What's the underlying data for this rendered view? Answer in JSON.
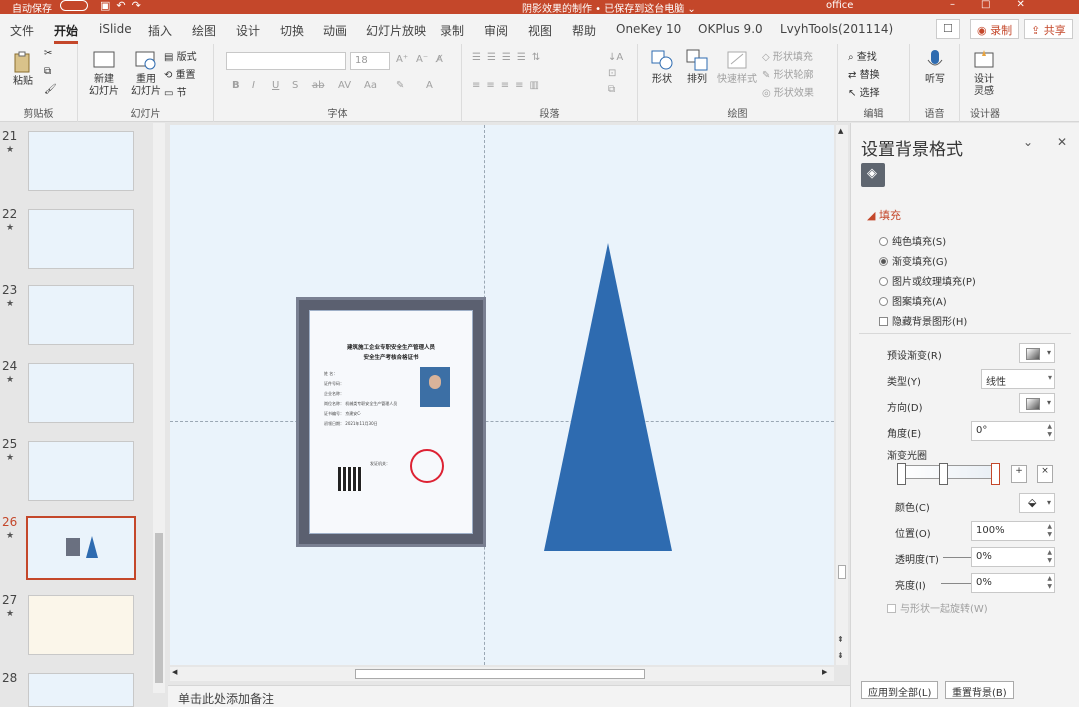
{
  "titlebar": {
    "autosave": "自动保存",
    "autosave_state": "关",
    "doc_title": "阴影效果的制作 • 已保存到这台电脑 ⌄",
    "account": "office",
    "qat_icons": [
      "save-icon",
      "undo-icon",
      "redo-icon"
    ]
  },
  "tabs": [
    {
      "label": "文件"
    },
    {
      "label": "开始",
      "active": true
    },
    {
      "label": "iSlide"
    },
    {
      "label": "插入"
    },
    {
      "label": "绘图"
    },
    {
      "label": "设计"
    },
    {
      "label": "切换"
    },
    {
      "label": "动画"
    },
    {
      "label": "幻灯片放映"
    },
    {
      "label": "录制"
    },
    {
      "label": "审阅"
    },
    {
      "label": "视图"
    },
    {
      "label": "帮助"
    },
    {
      "label": "OneKey 10"
    },
    {
      "label": "OKPlus 9.0"
    },
    {
      "label": "LvyhTools(201114)"
    }
  ],
  "tab_buttons": {
    "record": "录制",
    "share": "共享"
  },
  "ribbon": {
    "clipboard": {
      "paste": "粘贴",
      "group": "剪贴板"
    },
    "slides": {
      "new_slide": "新建\n幻灯片",
      "reuse": "重用\n幻灯片",
      "layout": "版式",
      "reset": "重置",
      "section": "节",
      "group": "幻灯片"
    },
    "font": {
      "size": "18",
      "group": "字体",
      "bold": "B",
      "italic": "I",
      "underline": "U",
      "strike": "S"
    },
    "paragraph": {
      "group": "段落"
    },
    "drawing": {
      "shapes": "形状",
      "arrange": "排列",
      "quick_styles": "快速样式",
      "fill": "形状填充",
      "outline": "形状轮廓",
      "effects": "形状效果",
      "group": "绘图"
    },
    "editing": {
      "find": "查找",
      "replace": "替换",
      "select": "选择",
      "group": "编辑"
    },
    "voice": {
      "dictate": "听写",
      "group": "语音"
    },
    "designer": {
      "ideas": "设计\n灵感",
      "group": "设计器"
    }
  },
  "thumbnails": [
    {
      "num": "21",
      "star": "★",
      "selected": false
    },
    {
      "num": "22",
      "star": "★",
      "selected": false
    },
    {
      "num": "23",
      "star": "★",
      "selected": false
    },
    {
      "num": "24",
      "star": "★",
      "selected": false
    },
    {
      "num": "25",
      "star": "★",
      "selected": false
    },
    {
      "num": "26",
      "star": "★",
      "selected": true
    },
    {
      "num": "27",
      "star": "★",
      "selected": false
    },
    {
      "num": "28",
      "star": "",
      "selected": false
    }
  ],
  "certificate": {
    "title_line1": "建筑施工企业专职安全生产管理人员",
    "title_line2": "安全生产考核合格证书",
    "fields": [
      "姓    名：",
      "证件号码：",
      "企业名称：",
      "岗位名称：  机械类专职安全生产管理人员",
      "证书编号：  京建安C·",
      "初领日期：  2021年11月30日"
    ],
    "footer": "发证机关：",
    "triangle_color": "#2e6bb0"
  },
  "notes": {
    "placeholder": "单击此处添加备注"
  },
  "format_pane": {
    "title": "设置背景格式",
    "section_fill": "填充",
    "fill_options": [
      {
        "label": "纯色填充(S)",
        "checked": false
      },
      {
        "label": "渐变填充(G)",
        "checked": true
      },
      {
        "label": "图片或纹理填充(P)",
        "checked": false
      },
      {
        "label": "图案填充(A)",
        "checked": false
      }
    ],
    "hide_bg": "隐藏背景图形(H)",
    "preset_label": "预设渐变(R)",
    "type_label": "类型(Y)",
    "type_value": "线性",
    "direction_label": "方向(D)",
    "angle_label": "角度(E)",
    "angle_value": "0°",
    "stops_label": "渐变光圈",
    "color_label": "颜色(C)",
    "position_label": "位置(O)",
    "position_value": "100%",
    "transparency_label": "透明度(T)",
    "transparency_value": "0%",
    "brightness_label": "亮度(I)",
    "brightness_value": "0%",
    "rotate_with_shape": "与形状一起旋转(W)",
    "apply_all": "应用到全部(L)",
    "reset_bg": "重置背景(B)"
  }
}
